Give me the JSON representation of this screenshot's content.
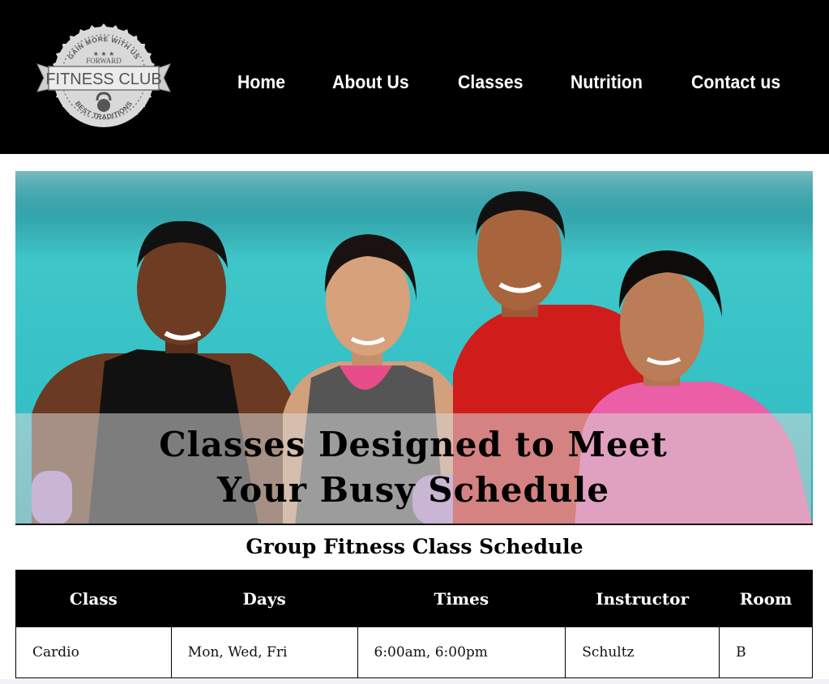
{
  "logo": {
    "top_arc": "GAIN MORE WITH US",
    "sub": "FORWARD",
    "name": "FITNESS CLUB",
    "bottom_arc": "BEST TRADITIONS"
  },
  "nav": {
    "items": [
      {
        "label": "Home"
      },
      {
        "label": "About Us"
      },
      {
        "label": "Classes"
      },
      {
        "label": "Nutrition"
      },
      {
        "label": "Contact us"
      }
    ]
  },
  "hero": {
    "line1": "Classes Designed to Meet",
    "line2": "Your Busy Schedule"
  },
  "schedule": {
    "title": "Group Fitness Class Schedule",
    "headers": [
      "Class",
      "Days",
      "Times",
      "Instructor",
      "Room"
    ],
    "rows": [
      [
        "Cardio",
        "Mon, Wed, Fri",
        "6:00am, 6:00pm",
        "Schultz",
        "B"
      ]
    ]
  },
  "colors": {
    "header_bg": "#000000",
    "nav_text": "#ffffff",
    "hero_bg": "#33bfc4"
  }
}
